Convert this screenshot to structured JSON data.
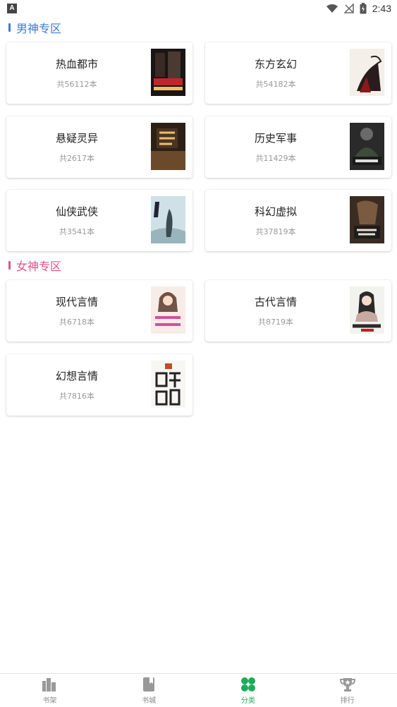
{
  "status_bar": {
    "time": "2:43",
    "left_badge": "A"
  },
  "sections": {
    "male": {
      "title": "男神专区",
      "accent": "#3a7bd5"
    },
    "female": {
      "title": "女神专区",
      "accent": "#e0508a"
    }
  },
  "categories": [
    {
      "name": "热血都市",
      "count": "共56112本"
    },
    {
      "name": "东方玄幻",
      "count": "共54182本"
    },
    {
      "name": "悬疑灵异",
      "count": "共2617本"
    },
    {
      "name": "历史军事",
      "count": "共11429本"
    },
    {
      "name": "仙侠武侠",
      "count": "共3541本"
    },
    {
      "name": "科幻虚拟",
      "count": "共37819本"
    },
    {
      "name": "现代言情",
      "count": "共6718本"
    },
    {
      "name": "古代言情",
      "count": "共8719本"
    },
    {
      "name": "幻想言情",
      "count": "共7816本"
    }
  ],
  "tabs": [
    {
      "label": "书架",
      "icon": "bookshelf-icon"
    },
    {
      "label": "书城",
      "icon": "book-icon"
    },
    {
      "label": "分类",
      "icon": "clover-icon",
      "active": true
    },
    {
      "label": "排行",
      "icon": "trophy-icon"
    }
  ],
  "colors": {
    "tab_active": "#1aad5a",
    "tab_inactive": "#888888"
  }
}
